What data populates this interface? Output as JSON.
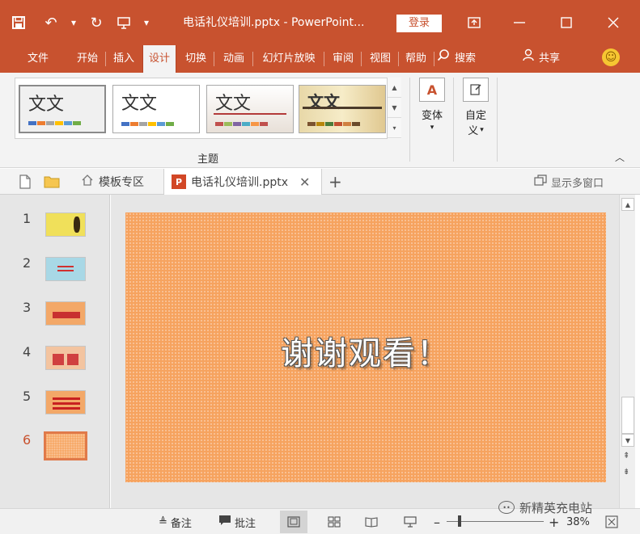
{
  "titlebar": {
    "title": "电话礼仪培训.pptx - PowerPoint...",
    "login_label": "登录",
    "accent_color": "#c8522f"
  },
  "ribbon_tabs": [
    "文件",
    "开始",
    "插入",
    "设计",
    "切换",
    "动画",
    "幻灯片放映",
    "审阅",
    "视图",
    "帮助"
  ],
  "ribbon_active_tab": "设计",
  "search": {
    "label": "搜索"
  },
  "share": {
    "label": "共享"
  },
  "ribbon": {
    "themes": [
      {
        "label": "文文",
        "swatches": [
          "#4472c4",
          "#ed7d31",
          "#a5a5a5",
          "#ffc000",
          "#5b9bd5",
          "#70ad47"
        ]
      },
      {
        "label": "文文",
        "swatches": [
          "#4472c4",
          "#ed7d31",
          "#a5a5a5",
          "#ffc000",
          "#5b9bd5",
          "#70ad47"
        ]
      },
      {
        "label": "文文",
        "swatches": [
          "#c0504d",
          "#9bbb59",
          "#8064a2",
          "#4bacc6",
          "#f79646",
          "#c0504d"
        ]
      },
      {
        "label": "文文",
        "swatches": [
          "#7a5230",
          "#b8860b",
          "#4a7b3a",
          "#c05030",
          "#d08040",
          "#6a4a2a"
        ]
      }
    ],
    "group_label": "主题",
    "variant_label": "变体",
    "customize_label_1": "自定",
    "customize_label_2": "义"
  },
  "doctabs": {
    "templates_label": "模板专区",
    "active_doc": "电话礼仪培训.pptx",
    "multiwindow_label": "显示多窗口"
  },
  "slides": [
    {
      "num": "1",
      "bg": "#f0e05a"
    },
    {
      "num": "2",
      "bg": "#a8d8e6"
    },
    {
      "num": "3",
      "bg": "#f3a868"
    },
    {
      "num": "4",
      "bg": "#f3c4a0"
    },
    {
      "num": "5",
      "bg": "#f3a868"
    },
    {
      "num": "6",
      "bg": "#f6a35f"
    }
  ],
  "active_slide": "6",
  "slide_text": "谢谢观看！",
  "statusbar": {
    "notes_label": "备注",
    "comments_label": "批注",
    "zoom": "38%"
  },
  "watermark": "新精英充电站"
}
